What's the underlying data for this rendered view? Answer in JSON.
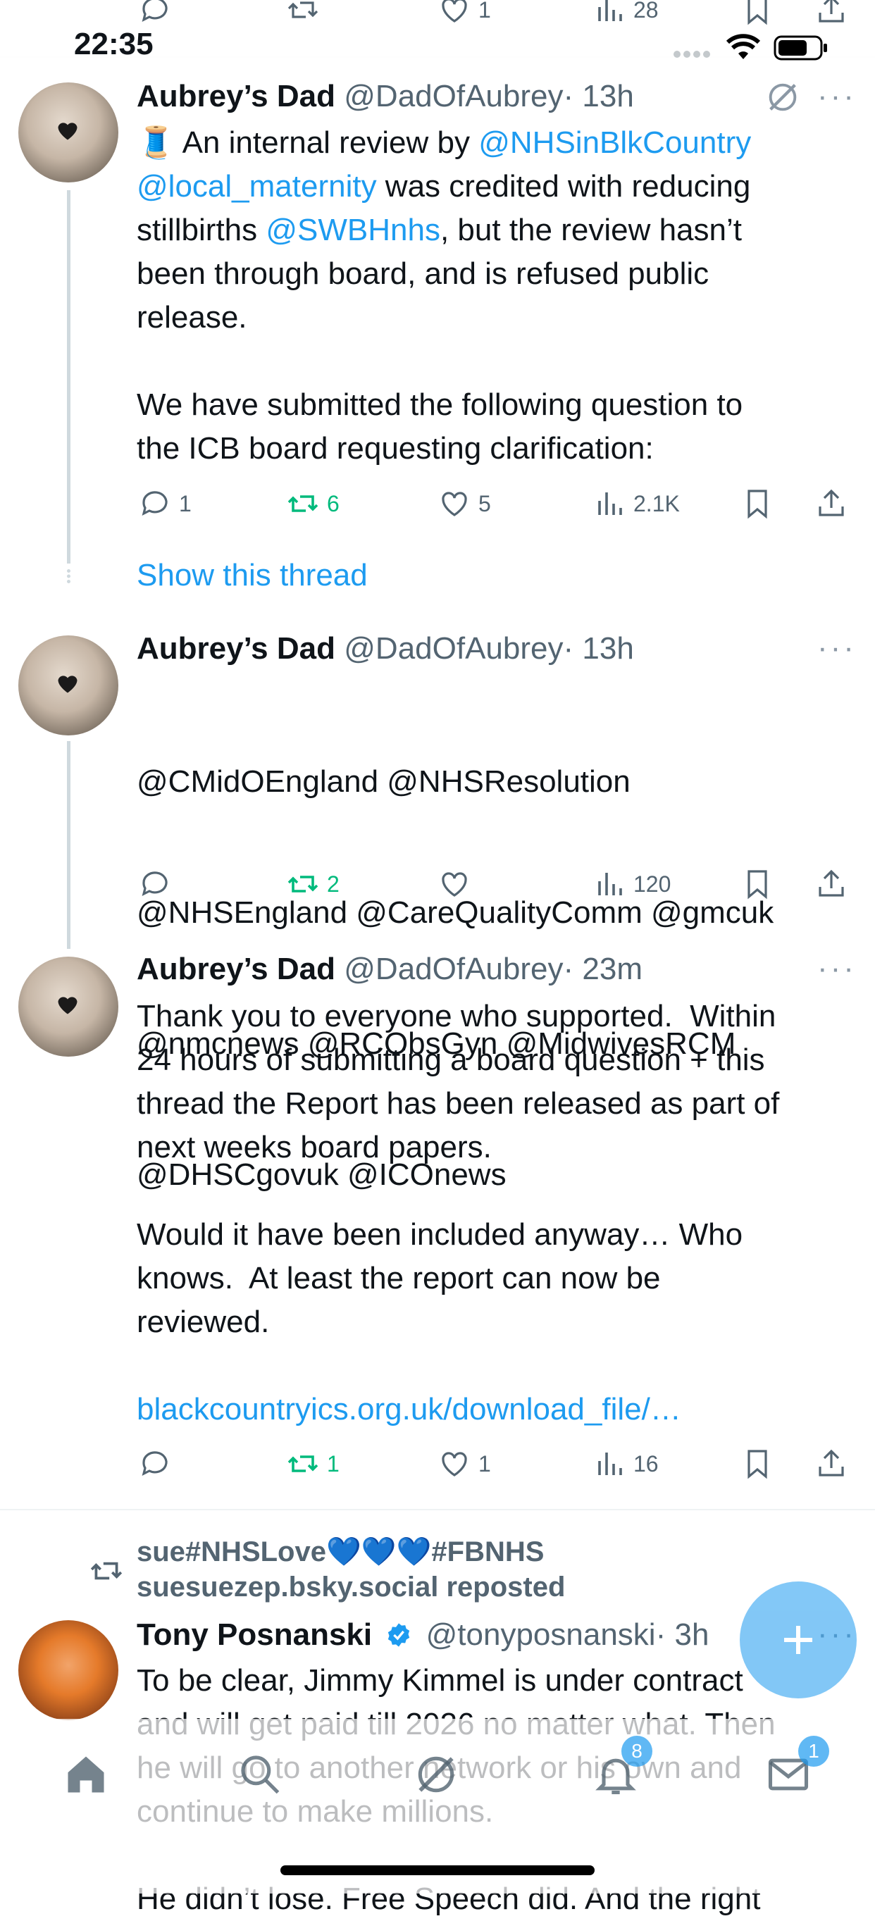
{
  "status_bar": {
    "time": "22:35"
  },
  "top_actions": {
    "replies": "",
    "retweets": "",
    "likes": "1",
    "views": "28"
  },
  "tweets": [
    {
      "display_name": "Aubrey’s Dad",
      "handle": "@DadOfAubrey",
      "time": "· 13h",
      "body_prefix": "🧵 An internal review by ",
      "mention_1": "@NHSinBlkCountry",
      "mention_2": "@local_maternity",
      "body_mid_1": " was credited with reducing",
      "body_mid_2": "stillbirths ",
      "mention_3": "@SWBHnhs",
      "body_rest": ", but the review hasn’t\nbeen through board, and is refused public\nrelease.\n\nWe have submitted the following question to\nthe ICB board requesting clarification:",
      "replies": "1",
      "retweets": "6",
      "likes": "5",
      "views": "2.1K",
      "show_thread": "Show this thread"
    },
    {
      "display_name": "Aubrey’s Dad",
      "handle": "@DadOfAubrey",
      "time": "· 13h",
      "mentions_line1": "@CMidOEngland @NHSResolution",
      "mentions_line2": "@NHSEngland @CareQualityComm @gmcuk",
      "mentions_line3": "@nmcnews @RCObsGyn @MidwivesRCM",
      "mentions_line4": "@DHSCgovuk @ICOnews",
      "replies": "",
      "retweets": "2",
      "likes": "",
      "views": "120"
    },
    {
      "display_name": "Aubrey’s Dad",
      "handle": "@DadOfAubrey",
      "time": "· 23m",
      "body": "Thank you to everyone who supported.  Within\n24 hours of submitting a board question + this\nthread the Report has been released as part of\nnext weeks board papers.\n\nWould it have been included anyway… Who\nknows.  At least the report can now be\nreviewed.",
      "link": "blackcountryics.org.uk/download_file/…",
      "replies": "",
      "retweets": "1",
      "likes": "1",
      "views": "16"
    }
  ],
  "repost": {
    "line1": "sue#NHSLove💙💙💙#FBNHS",
    "line2": "suesuezep.bsky.social reposted"
  },
  "tweet4": {
    "display_name": "Tony Posnanski",
    "handle": "@tonyposnanski",
    "time": "· 3h",
    "body": "To be clear, Jimmy Kimmel is under contract\nand will get paid till 2026 no matter what. Then\nhe will go to another network or his own and\ncontinue to make millions.\n\nHe didn’t lose. Free Speech did. And the right"
  },
  "tabbar": {
    "notifications_badge": "8",
    "messages_badge": "1"
  },
  "colors": {
    "accent": "#1d9bf0",
    "retweet_green": "#00ba7c",
    "muted": "#536471"
  }
}
